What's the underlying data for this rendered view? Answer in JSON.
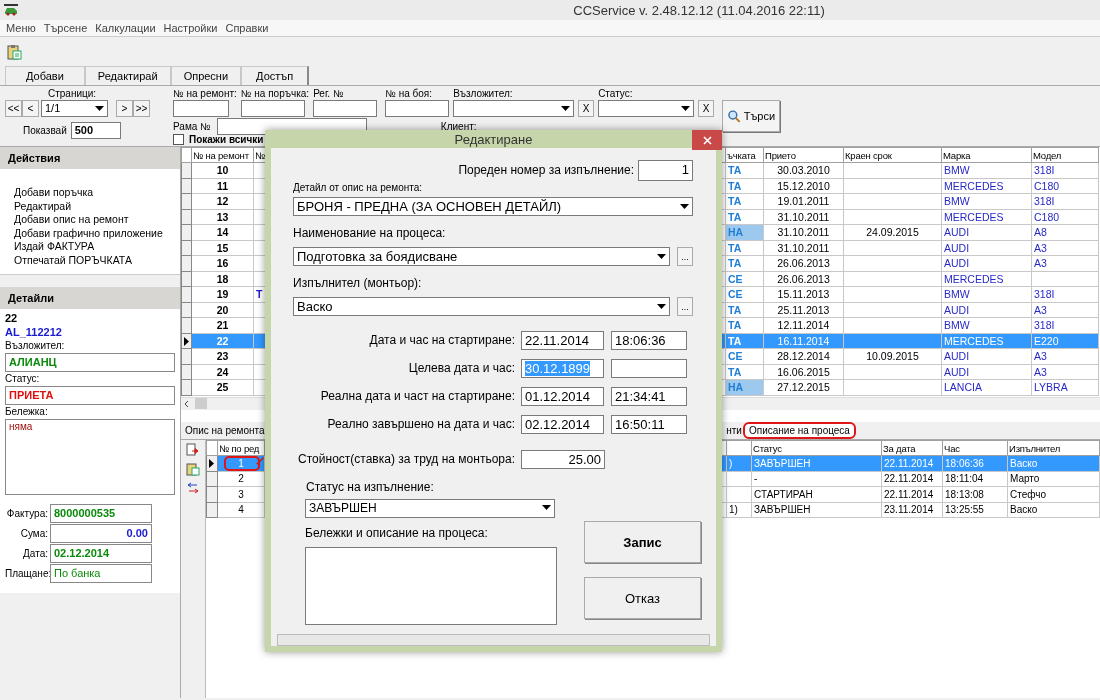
{
  "window": {
    "title": "CCService v. 2.48.12.12 (11.04.2016 22:11)"
  },
  "menu": [
    "Меню",
    "Търсене",
    "Калкулации",
    "Настройки",
    "Справки"
  ],
  "toolbar_buttons": [
    "Добави",
    "Редактирай",
    "Опресни",
    "Достъп"
  ],
  "filters": {
    "pages_label": "Страници:",
    "prev_buttons": [
      "<<",
      "<"
    ],
    "page": "1/1",
    "next_buttons": [
      ">",
      ">>"
    ],
    "show_label": "Показвай",
    "show_value": "500",
    "fields": [
      {
        "label": "№ на ремонт:"
      },
      {
        "label": "№ на поръчка:"
      },
      {
        "label": "Рег. №"
      },
      {
        "label": "№ на боя:"
      }
    ],
    "contractor_label": "Възложител:",
    "status_label": "Статус:",
    "clear_buttons": [
      "X",
      "X"
    ],
    "search_button": "Търси",
    "frame_label": "Рама №",
    "client_label": "Клиент:",
    "show_all": {
      "label": "Покажи всички",
      "checked": false
    }
  },
  "actions": {
    "title": "Действия",
    "items": [
      "Добави поръчка",
      "Редактирай",
      "Добави опис на ремонт",
      "Добави графично приложение",
      "Издай ФАКТУРА",
      "Отпечатай ПОРЪЧКАТА"
    ]
  },
  "details": {
    "title": "Детайли",
    "number": "22",
    "code": "AL_112212",
    "contractor_label": "Възложител:",
    "contractor": "АЛИАНЦ",
    "status_label": "Статус:",
    "status": "ПРИЕТА",
    "note_label": "Бележка:",
    "note": "няма",
    "rows": [
      {
        "label": "Фактура:",
        "value": "8000000535",
        "kind": "green"
      },
      {
        "label": "Сума:",
        "value": "0.00",
        "kind": "amount"
      },
      {
        "label": "Дата:",
        "value": "02.12.2014",
        "kind": "greenbold"
      },
      {
        "label": "Плащане:",
        "value": "По банка",
        "kind": "green"
      }
    ]
  },
  "orders": {
    "columns": [
      "№ на ремонт",
      "№",
      "ъчката",
      "Прието",
      "Краен срок",
      "Марка",
      "Модел"
    ],
    "rows": [
      {
        "number": "10",
        "column_3": "ТА",
        "received": "30.03.2010",
        "make": "BMW",
        "model": "318I",
        "selected": false,
        "column_3_marked": false
      },
      {
        "number": "11",
        "column_3": "ТА",
        "received": "15.12.2010",
        "make": "MERCEDES",
        "model": "C180",
        "selected": false,
        "column_3_marked": false
      },
      {
        "number": "12",
        "column_3": "ТА",
        "received": "19.01.2011",
        "make": "BMW",
        "model": "318I",
        "selected": false,
        "column_3_marked": false
      },
      {
        "number": "13",
        "column_3": "ТА",
        "received": "31.10.2011",
        "make": "MERCEDES",
        "model": "C180",
        "selected": false,
        "column_3_marked": false
      },
      {
        "number": "14",
        "column_3": "НА",
        "received": "31.10.2011",
        "deadline": "24.09.2015",
        "make": "AUDI",
        "model": "A8",
        "selected": false,
        "column_3_marked": true
      },
      {
        "number": "15",
        "column_3": "ТА",
        "received": "31.10.2011",
        "make": "AUDI",
        "model": "A3",
        "selected": false,
        "column_3_marked": false
      },
      {
        "number": "16",
        "column_3": "ТА",
        "received": "26.06.2013",
        "make": "AUDI",
        "model": "A3",
        "selected": false,
        "column_3_marked": false
      },
      {
        "number": "18",
        "column_3": "СЕ",
        "received": "26.06.2013",
        "make": "MERCEDES",
        "selected": false,
        "column_3_marked": false
      },
      {
        "number": "19",
        "column_2": "Т",
        "column_3": "СЕ",
        "received": "15.11.2013",
        "make": "BMW",
        "model": "318I",
        "selected": false,
        "column_3_marked": false
      },
      {
        "number": "20",
        "column_3": "ТА",
        "received": "25.11.2013",
        "make": "AUDI",
        "model": "A3",
        "selected": false,
        "column_3_marked": false
      },
      {
        "number": "21",
        "column_3": "ТА",
        "received": "12.11.2014",
        "make": "BMW",
        "model": "318I",
        "selected": false,
        "column_3_marked": false
      },
      {
        "number": "22",
        "column_3": "ТА",
        "received": "16.11.2014",
        "make": "MERCEDES",
        "model": "E220",
        "selected": true,
        "column_3_marked": false
      },
      {
        "number": "23",
        "column_3": "СЕ",
        "received": "28.12.2014",
        "deadline": "10.09.2015",
        "make": "AUDI",
        "model": "A3",
        "selected": false,
        "column_3_marked": false
      },
      {
        "number": "24",
        "column_3": "ТА",
        "received": "16.06.2015",
        "make": "AUDI",
        "model": "A3",
        "selected": false,
        "column_3_marked": false
      },
      {
        "number": "25",
        "column_3": "НА",
        "received": "27.12.2015",
        "make": "LANCIA",
        "model": "LYBRA",
        "selected": false,
        "column_3_marked": true
      }
    ]
  },
  "bottom_tabs": [
    {
      "label": "Опис на ремонта",
      "selected": false,
      "circled": false
    },
    {
      "label": "нти",
      "selected": false,
      "circled": false
    },
    {
      "label": "Описание на процеса",
      "selected": true,
      "circled": true
    }
  ],
  "processes": {
    "columns": [
      "№ по ред",
      "Статус",
      "За дата",
      "Час",
      "Изпълнител"
    ],
    "rows": [
      {
        "index": "1",
        "column_2": ")",
        "status": "ЗАВЪРШЕН",
        "date": "22.11.2014",
        "time": "18:06:36",
        "worker": "Васко",
        "selected": true,
        "circled": true
      },
      {
        "index": "2",
        "status": "-",
        "date": "22.11.2014",
        "time": "18:11:04",
        "worker": "Марто",
        "selected": false,
        "circled": false
      },
      {
        "index": "3",
        "status": "СТАРТИРАН",
        "date": "22.11.2014",
        "time": "18:13:08",
        "worker": "Стефчо",
        "selected": false,
        "circled": false
      },
      {
        "index": "4",
        "column_2": "1)",
        "status": "ЗАВЪРШЕН",
        "date": "23.11.2014",
        "time": "13:25:55",
        "worker": "Васко",
        "selected": false,
        "circled": false
      }
    ]
  },
  "dialog": {
    "title": "Редактиране",
    "order_label": "Пореден номер за изпълнение:",
    "order_value": "1",
    "detail_label": "Детайл от опис на ремонта:",
    "detail_value": "БРОНЯ - ПРЕДНА (ЗА ОСНОВЕН ДЕТАЙЛ)",
    "process_label": "Наименование на процеса:",
    "process_value": "Подготовка за боядисване",
    "worker_label": "Изпълнител (монтьор):",
    "worker_value": "Васко",
    "more_button": "...",
    "date_rows": [
      {
        "label": "Дата и час на стартиране:",
        "date": "22.11.2014",
        "time": "18:06:36",
        "selected": false
      },
      {
        "label": "Целева дата и час:",
        "date": "30.12.1899",
        "selected": true
      },
      {
        "label": "Реална дата и част на стартиране:",
        "date": "01.12.2014",
        "time": "21:34:41",
        "selected": false
      },
      {
        "label": "Реално завършено на дата и час:",
        "date": "02.12.2014",
        "time": "16:50:11",
        "selected": false
      }
    ],
    "rate_label": "Стойност(ставка) за труд на монтьора:",
    "rate": "25.00",
    "status_label": "Статус на изпълнение:",
    "status_value": "ЗАВЪРШЕН",
    "notes_label": "Бележки и описание на процеса:",
    "save": "Запис",
    "cancel": "Отказ"
  }
}
